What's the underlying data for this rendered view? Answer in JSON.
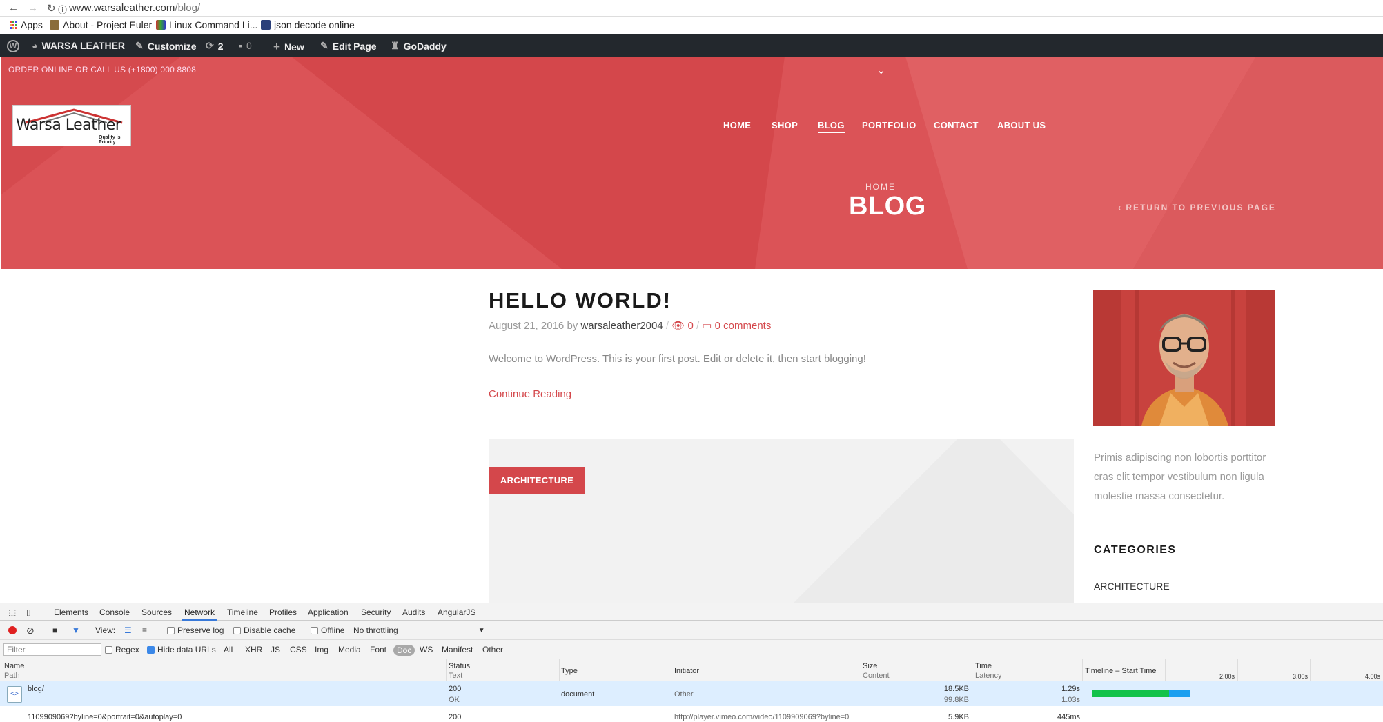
{
  "browser": {
    "url_host": "www.warsaleather.com",
    "url_path": "/blog/",
    "bookmarks": [
      "Apps",
      "About - Project Euler",
      "Linux Command Li...",
      "json decode online"
    ]
  },
  "wp_admin_bar": {
    "site_name": "WARSA LEATHER",
    "customize": "Customize",
    "updates_count": "2",
    "comments_count": "0",
    "new_label": "New",
    "edit_page": "Edit Page",
    "godaddy": "GoDaddy"
  },
  "hero": {
    "topline": "ORDER ONLINE OR CALL US (+1800) 000 8808",
    "logo_text": "Warsa Leather",
    "logo_tagline": "Quality is Priority",
    "menu": [
      "HOME",
      "SHOP",
      "BLOG",
      "PORTFOLIO",
      "CONTACT",
      "ABOUT US"
    ],
    "active_menu": "BLOG",
    "breadcrumb": "HOME",
    "title": "BLOG",
    "return_link": "‹ RETURN TO PREVIOUS PAGE",
    "color": "#d4474b"
  },
  "post": {
    "title": "HELLO WORLD!",
    "date": "August 21, 2016",
    "by": "by",
    "author": "warsaleather2004",
    "views": "0",
    "comments": "0 comments",
    "excerpt": "Welcome to WordPress. This is your first post. Edit or delete it, then start blogging!",
    "continue": "Continue Reading",
    "category_button": "ARCHITECTURE"
  },
  "sidebar": {
    "about_text": "Primis adipiscing non lobortis porttitor cras elit tempor vestibulum non ligula molestie massa consectetur.",
    "categories_heading": "CATEGORIES",
    "categories": [
      "ARCHITECTURE"
    ]
  },
  "devtools": {
    "tabs": [
      "Elements",
      "Console",
      "Sources",
      "Network",
      "Timeline",
      "Profiles",
      "Application",
      "Security",
      "Audits",
      "AngularJS"
    ],
    "selected_tab": "Network",
    "view_label": "View:",
    "preserve_log": "Preserve log",
    "disable_cache": "Disable cache",
    "offline": "Offline",
    "throttling": "No throttling",
    "filter_placeholder": "Filter",
    "regex": "Regex",
    "hide_data_urls": "Hide data URLs",
    "type_filters": [
      "All",
      "XHR",
      "JS",
      "CSS",
      "Img",
      "Media",
      "Font",
      "Doc",
      "WS",
      "Manifest",
      "Other"
    ],
    "selected_type": "Doc",
    "columns": {
      "name": "Name",
      "path": "Path",
      "status": "Status",
      "text": "Text",
      "type": "Type",
      "initiator": "Initiator",
      "size": "Size",
      "content": "Content",
      "time": "Time",
      "latency": "Latency",
      "timeline": "Timeline – Start Time"
    },
    "timeline_ticks": [
      "2.00s",
      "3.00s",
      "4.00s"
    ],
    "row": {
      "name": "blog/",
      "status": "200",
      "status_text": "OK",
      "type": "document",
      "initiator": "Other",
      "size": "18.5KB",
      "content": "99.8KB",
      "time": "1.29s",
      "latency": "1.03s"
    },
    "row2": {
      "name": "1109909069?byline=0&portrait=0&autoplay=0",
      "status": "200",
      "initiator": "http://player.vimeo.com/video/1109909069?byline=0",
      "size": "5.9KB",
      "time": "445ms"
    }
  }
}
